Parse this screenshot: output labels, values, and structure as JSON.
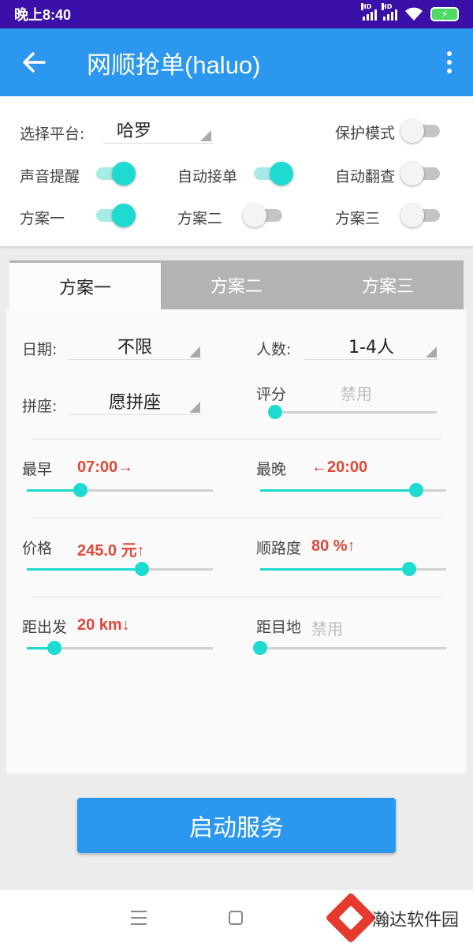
{
  "status_bar": {
    "time": "晚上8:40",
    "hd1": "HD",
    "hd2": "HD",
    "battery_icon": "charging-battery-icon",
    "wifi_icon": "wifi-icon",
    "battery_color": "#4cd964"
  },
  "app_bar": {
    "title": "网顺抢单(haluo)",
    "back_icon": "back-arrow-icon",
    "menu_icon": "more-vert-icon",
    "color": "#2c97ee"
  },
  "settings": {
    "platform_label": "选择平台:",
    "platform_value": "哈罗",
    "protect_mode": {
      "label": "保护模式",
      "on": false
    },
    "sound_alert": {
      "label": "声音提醒",
      "on": true
    },
    "auto_accept": {
      "label": "自动接单",
      "on": true
    },
    "auto_flip": {
      "label": "自动翻查",
      "on": false
    },
    "plan1": {
      "label": "方案一",
      "on": true
    },
    "plan2": {
      "label": "方案二",
      "on": false
    },
    "plan3": {
      "label": "方案三",
      "on": false
    },
    "accent_color": "#1ddbd0"
  },
  "tabs": [
    {
      "label": "方案一",
      "active": true
    },
    {
      "label": "方案二",
      "active": false
    },
    {
      "label": "方案三",
      "active": false
    }
  ],
  "plan": {
    "date": {
      "label": "日期:",
      "value": "不限"
    },
    "people": {
      "label": "人数:",
      "value": "1-4人"
    },
    "carpool": {
      "label": "拼座:",
      "value": "愿拼座"
    },
    "rating": {
      "label": "评分",
      "value": "禁用",
      "level": 0
    },
    "earliest": {
      "label": "最早",
      "value": "07:00→",
      "level": 0.29
    },
    "latest": {
      "label": "最晚",
      "value": "←20:00",
      "level": 0.84
    },
    "price": {
      "label": "价格",
      "value": "245.0 元↑",
      "level": 0.62
    },
    "route": {
      "label": "顺路度",
      "value": "80 %↑",
      "level": 0.8
    },
    "distance_start": {
      "label": "距出发",
      "value": "20 km↓",
      "level": 0.15
    },
    "distance_dest": {
      "label": "距目地",
      "value": "禁用",
      "level": 0
    }
  },
  "start_button": {
    "label": "启动服务"
  },
  "nav_bar": {
    "menu_icon": "menu-lines-icon",
    "home_icon": "home-square-icon"
  },
  "watermark": {
    "text": "瀚达软件园",
    "logo": "handa-logo-icon"
  }
}
